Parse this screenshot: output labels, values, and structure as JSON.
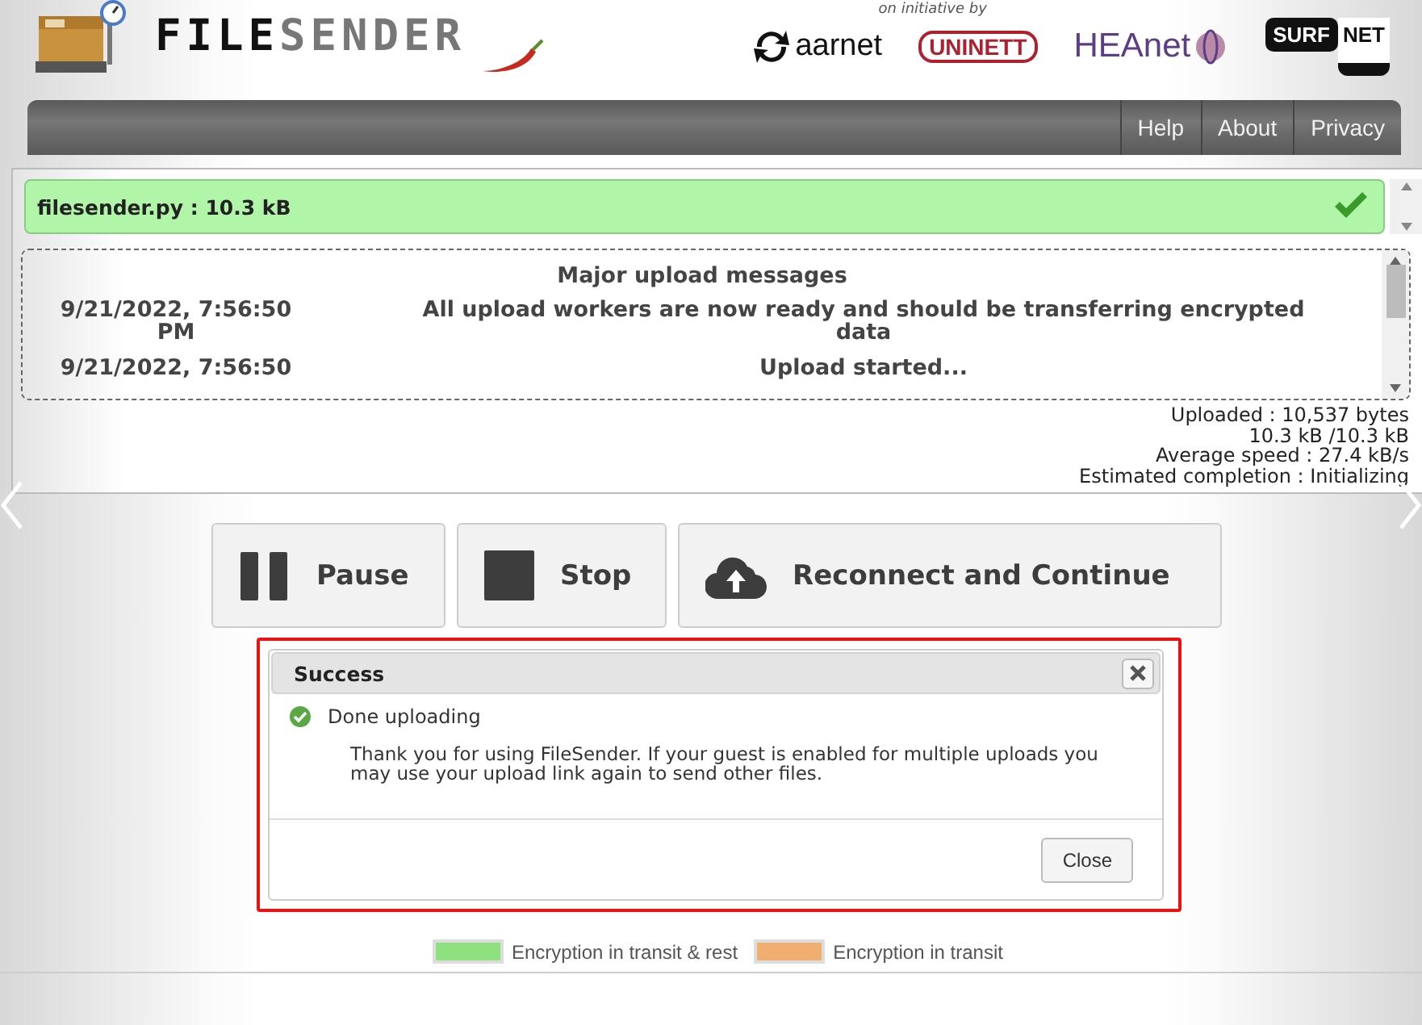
{
  "header": {
    "logo_first": "FILE",
    "logo_second": "SENDER",
    "tagline": "on initiative by",
    "partners": [
      {
        "kind": "aarnet",
        "text": "aarnet"
      },
      {
        "kind": "uninett",
        "text": "UNINETT"
      },
      {
        "kind": "heanet",
        "text": "HEAnet"
      },
      {
        "kind": "surfnet",
        "text": "SURF",
        "text2": "NET"
      }
    ]
  },
  "nav": [
    {
      "label": "Help"
    },
    {
      "label": "About"
    },
    {
      "label": "Privacy"
    }
  ],
  "upload": {
    "file": "filesender.py : 10.3 kB",
    "complete": true,
    "messages_title": "Major upload messages",
    "messages": [
      {
        "time": "9/21/2022, 7:56:50 PM",
        "text": "All upload workers are now ready and should be transferring encrypted data"
      },
      {
        "time": "9/21/2022, 7:56:50",
        "text": "Upload started..."
      }
    ],
    "stats": [
      "Uploaded : 10,537 bytes",
      "10.3 kB /10.3 kB",
      "Average speed : 27.4 kB/s",
      "Estimated completion : Initializing"
    ]
  },
  "buttons": [
    {
      "kind": "pause",
      "label": "Pause"
    },
    {
      "kind": "stop",
      "label": "Stop"
    },
    {
      "kind": "reconnect",
      "label": "Reconnect and Continue"
    }
  ],
  "dialog": {
    "title": "Success",
    "message": "Done uploading",
    "body": "Thank you for using FileSender. If your guest is enabled for multiple uploads you may use your upload link again to send other files.",
    "close_label": "Close"
  },
  "legend": [
    {
      "label": "Encryption in transit & rest",
      "color": "#8fe07e"
    },
    {
      "label": "Encryption in transit",
      "color": "#f0ae70"
    }
  ]
}
